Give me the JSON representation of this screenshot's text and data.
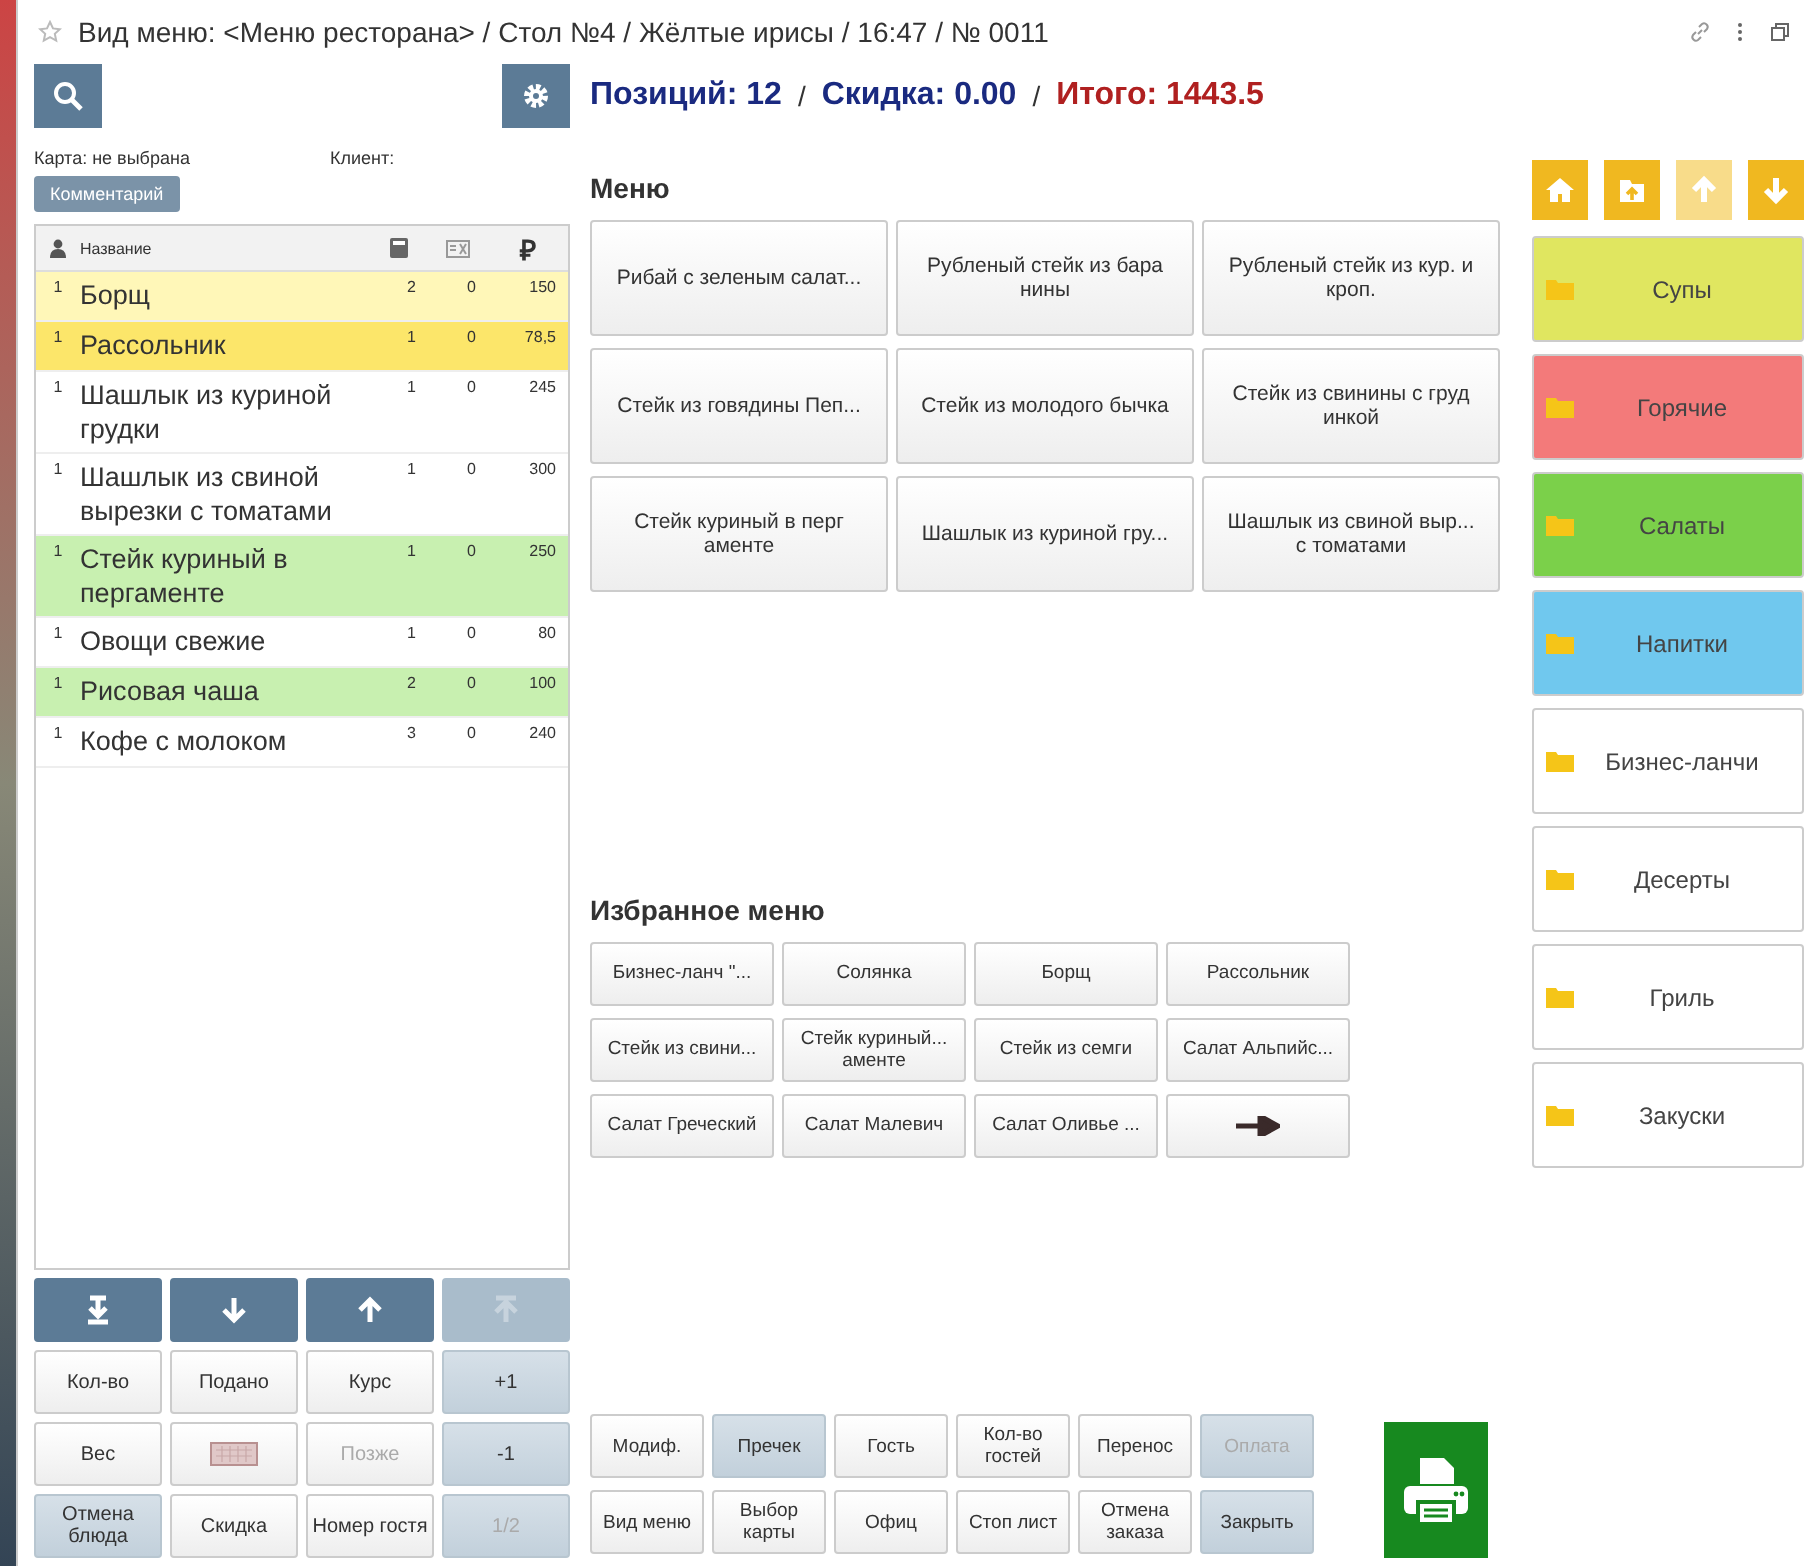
{
  "window": {
    "title": "Вид меню: <Меню ресторана> / Стол №4 / Жёлтые ирисы / 16:47 / № 0011"
  },
  "summary": {
    "positions": "Позиций: 12",
    "separator_1": "/",
    "discount": "Скидка: 0.00",
    "separator_2": "/",
    "total": "Итого: 1443.5"
  },
  "card": {
    "card_label": "Карта: не выбрана",
    "client_label": "Клиент:",
    "comment_button": "Комментарий"
  },
  "order_table": {
    "columns": {
      "name": "Название",
      "price": "₽"
    },
    "rows": [
      {
        "mark": "1",
        "name": "Борщ",
        "qty": "2",
        "col_3": "0",
        "price": "150",
        "color": "#fff7b8"
      },
      {
        "mark": "1",
        "name": "Рассольник",
        "qty": "1",
        "col_3": "0",
        "price": "78,5",
        "color": "#fce66a"
      },
      {
        "mark": "1",
        "name": "Шашлык из куриной грудки",
        "qty": "1",
        "col_3": "0",
        "price": "245",
        "color": "#ffffff"
      },
      {
        "mark": "1",
        "name": "Шашлык из свиной вырезки с томатами",
        "qty": "1",
        "col_3": "0",
        "price": "300",
        "color": "#ffffff"
      },
      {
        "mark": "1",
        "name": "Стейк куриный в пергаменте",
        "qty": "1",
        "col_3": "0",
        "price": "250",
        "color": "#c8f0b0"
      },
      {
        "mark": "1",
        "name": "Овощи свежие",
        "qty": "1",
        "col_3": "0",
        "price": "80",
        "color": "#ffffff"
      },
      {
        "mark": "1",
        "name": "Рисовая чаша",
        "qty": "2",
        "col_3": "0",
        "price": "100",
        "color": "#c8f0b0"
      },
      {
        "mark": "1",
        "name": "Кофе с молоком",
        "qty": "3",
        "col_3": "0",
        "price": "240",
        "color": "#ffffff"
      }
    ]
  },
  "order_buttons": [
    {
      "kind": "to-bottom",
      "disabled": false
    },
    {
      "kind": "down",
      "disabled": false
    },
    {
      "kind": "up",
      "disabled": false
    },
    {
      "kind": "to-top",
      "disabled": true
    },
    {
      "kind": "plain",
      "label": "Кол-во",
      "disabled": false
    },
    {
      "kind": "plain",
      "label": "Подано",
      "disabled": false
    },
    {
      "kind": "plain",
      "label": "Курс",
      "disabled": false
    },
    {
      "kind": "shaded",
      "label": "+1",
      "disabled": false
    },
    {
      "kind": "plain",
      "label": "Вес",
      "disabled": false
    },
    {
      "kind": "keyboard",
      "disabled": false
    },
    {
      "kind": "plain",
      "label": "Позже",
      "disabled": true
    },
    {
      "kind": "shaded",
      "label": "-1",
      "disabled": false
    },
    {
      "kind": "shaded",
      "label": "Отмена блюда",
      "disabled": false
    },
    {
      "kind": "plain",
      "label": "Скидка",
      "disabled": false
    },
    {
      "kind": "plain",
      "label": "Номер гостя",
      "disabled": false
    },
    {
      "kind": "shaded",
      "label": "1/2",
      "disabled": true
    }
  ],
  "menu": {
    "title": "Меню",
    "items": [
      "Рибай с зеленым салат...",
      "Рубленый стейк из бара нины",
      "Рубленый стейк из кур. и кроп.",
      "Стейк из говядины Пеп...",
      "Стейк из молодого бычка",
      "Стейк из свинины с груд инкой",
      "Стейк куриный в перг аменте",
      "Шашлык из куриной гру...",
      "Шашлык из свиной выр... с томатами"
    ]
  },
  "favorites": {
    "title": "Избранное меню",
    "items": [
      {
        "kind": "text",
        "label": "Бизнес-ланч \"..."
      },
      {
        "kind": "text",
        "label": "Солянка"
      },
      {
        "kind": "text",
        "label": "Борщ"
      },
      {
        "kind": "text",
        "label": "Рассольник"
      },
      {
        "kind": "text",
        "label": "Стейк из свини..."
      },
      {
        "kind": "text",
        "label": "Стейк куриный... аменте"
      },
      {
        "kind": "text",
        "label": "Стейк из семги"
      },
      {
        "kind": "text",
        "label": "Салат Альпийс..."
      },
      {
        "kind": "text",
        "label": "Салат Греческий"
      },
      {
        "kind": "text",
        "label": "Салат Малевич"
      },
      {
        "kind": "text",
        "label": "Салат Оливье ..."
      },
      {
        "kind": "next"
      }
    ]
  },
  "actions": [
    {
      "kind": "plain",
      "label": "Модиф.",
      "disabled": false
    },
    {
      "kind": "shaded",
      "label": "Пречек",
      "disabled": false
    },
    {
      "kind": "plain",
      "label": "Гость",
      "disabled": false
    },
    {
      "kind": "plain",
      "label": "Кол-во гостей",
      "disabled": false
    },
    {
      "kind": "plain",
      "label": "Перенос",
      "disabled": false
    },
    {
      "kind": "shaded",
      "label": "Оплата",
      "disabled": true
    },
    {
      "kind": "plain",
      "label": "Вид меню",
      "disabled": false
    },
    {
      "kind": "plain",
      "label": "Выбор карты",
      "disabled": false
    },
    {
      "kind": "plain",
      "label": "Офиц",
      "disabled": false
    },
    {
      "kind": "plain",
      "label": "Стоп лист",
      "disabled": false
    },
    {
      "kind": "plain",
      "label": "Отмена заказа",
      "disabled": false
    },
    {
      "kind": "shaded",
      "label": "Закрыть",
      "disabled": false
    }
  ],
  "nav_buttons": [
    {
      "kind": "home",
      "disabled": false
    },
    {
      "kind": "folder-up",
      "disabled": false
    },
    {
      "kind": "up",
      "disabled": true
    },
    {
      "kind": "down",
      "disabled": false
    }
  ],
  "categories": [
    {
      "label": "Супы",
      "color": "#e0e660"
    },
    {
      "label": "Горячие",
      "color": "#f37a7a"
    },
    {
      "label": "Салаты",
      "color": "#7bd04a"
    },
    {
      "label": "Напитки",
      "color": "#70c8ee"
    },
    {
      "label": "Бизнес-ланчи",
      "color": "#ffffff"
    },
    {
      "label": "Десерты",
      "color": "#ffffff"
    },
    {
      "label": "Гриль",
      "color": "#ffffff"
    },
    {
      "label": "Закуски",
      "color": "#ffffff"
    }
  ]
}
